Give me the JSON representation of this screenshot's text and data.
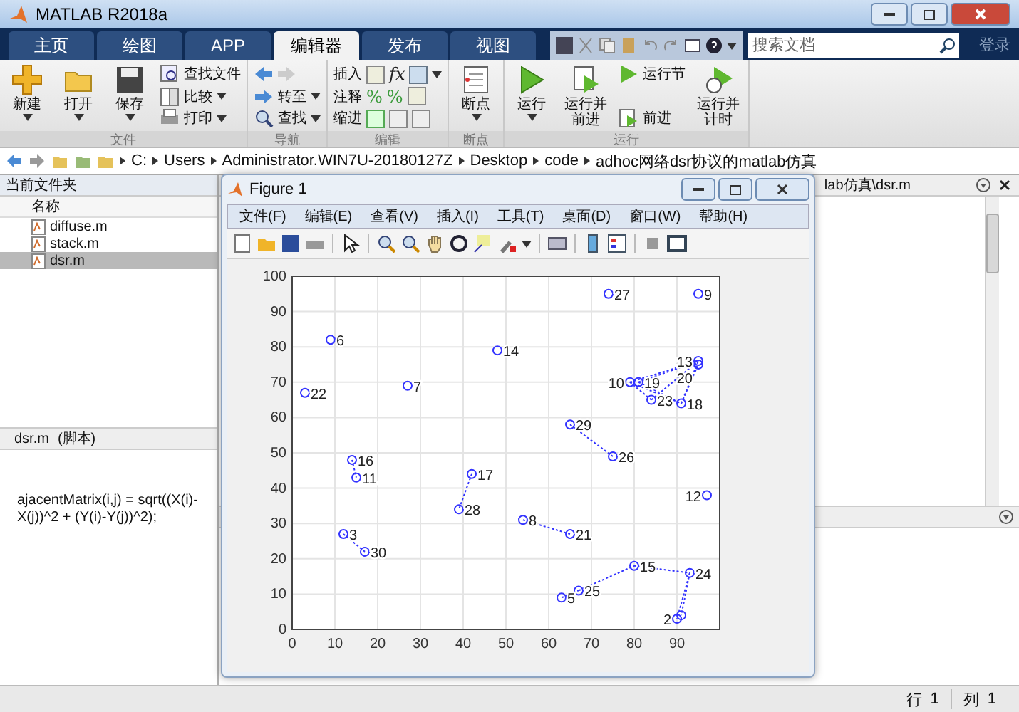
{
  "window": {
    "title": "MATLAB R2018a"
  },
  "tabs": [
    {
      "label": "主页",
      "selected": false
    },
    {
      "label": "绘图",
      "selected": false
    },
    {
      "label": "APP",
      "selected": false
    },
    {
      "label": "编辑器",
      "selected": true
    },
    {
      "label": "发布",
      "selected": false
    },
    {
      "label": "视图",
      "selected": false
    }
  ],
  "search": {
    "placeholder": "搜索文档"
  },
  "login": "登录",
  "ribbon": [
    {
      "title": "文件",
      "items": [
        {
          "kind": "large",
          "label": "新建",
          "dropdown": true
        },
        {
          "kind": "large",
          "label": "打开",
          "dropdown": true
        },
        {
          "kind": "large",
          "label": "保存",
          "dropdown": true
        },
        {
          "kind": "stack",
          "rows": [
            {
              "label": "查找文件",
              "dropdown": false
            },
            {
              "label": "比较",
              "dropdown": true
            },
            {
              "label": "打印",
              "dropdown": true
            }
          ]
        }
      ]
    },
    {
      "title": "导航",
      "items": [
        {
          "kind": "stack",
          "rows": [
            {
              "dropdown": false
            },
            {
              "label": "转至",
              "dropdown": true
            },
            {
              "label": "查找",
              "dropdown": true
            }
          ]
        }
      ]
    },
    {
      "title": "编辑",
      "items": [
        {
          "kind": "stack",
          "rows": [
            {
              "label": "插入",
              "glyphs": [
                "fx"
              ],
              "dropdown": true
            },
            {
              "label": "注释",
              "glyphs": [
                "%",
                "%"
              ],
              "dropdown": false
            },
            {
              "label": "缩进",
              "dropdown": false
            }
          ]
        }
      ]
    },
    {
      "title": "断点",
      "items": [
        {
          "kind": "large",
          "label": "断点",
          "dropdown": true
        }
      ]
    },
    {
      "title": "运行",
      "items": [
        {
          "kind": "large",
          "label": "运行",
          "dropdown": true
        },
        {
          "kind": "large",
          "label": "运行并前进",
          "dropdown": false
        },
        {
          "kind": "stack",
          "rows": [
            {
              "label": "运行节",
              "dropdown": false
            },
            {
              "label": "前进",
              "dropdown": false
            }
          ]
        },
        {
          "kind": "large",
          "label": "运行并计时",
          "dropdown": false
        }
      ]
    }
  ],
  "address": [
    "C:",
    "Users",
    "Administrator.WIN7U-20180127Z",
    "Desktop",
    "code",
    "adhoc网络dsr协议的matlab仿真"
  ],
  "file_browser": {
    "title": "当前文件夹",
    "column": "名称",
    "files": [
      {
        "name": "diffuse.m",
        "selected": false
      },
      {
        "name": "stack.m",
        "selected": false
      },
      {
        "name": "dsr.m",
        "selected": true
      }
    ]
  },
  "details": {
    "title": "dsr.m",
    "subtitle": "(脚本)",
    "text": "ajacentMatrix(i,j) = sqrt((X(i)-X(j))^2 + (Y(i)-Y(j))^2);"
  },
  "editor": {
    "tab": "lab仿真\\dsr.m"
  },
  "status_bar": {
    "row_label": "行",
    "row": "1",
    "col_label": "列",
    "col": "1"
  },
  "figure": {
    "title": "Figure 1",
    "menu": [
      "文件(F)",
      "编辑(E)",
      "查看(V)",
      "插入(I)",
      "工具(T)",
      "桌面(D)",
      "窗口(W)",
      "帮助(H)"
    ],
    "chart_data": {
      "type": "scatter",
      "xlim": [
        0,
        100
      ],
      "ylim": [
        0,
        100
      ],
      "xticks": [
        0,
        10,
        20,
        30,
        40,
        50,
        60,
        70,
        80,
        90
      ],
      "yticks": [
        0,
        10,
        20,
        30,
        40,
        50,
        60,
        70,
        80,
        90,
        100
      ],
      "x": [
        74,
        95,
        9,
        48,
        95,
        95,
        3,
        27,
        79,
        81,
        84,
        91,
        65,
        75,
        14,
        15,
        42,
        97,
        39,
        54,
        65,
        12,
        17,
        80,
        93,
        67,
        63,
        90,
        91
      ],
      "series": [
        {
          "color": "#3333ff",
          "values": [
            95,
            95,
            82,
            79,
            76,
            75,
            67,
            69,
            70,
            70,
            65,
            64,
            58,
            49,
            48,
            43,
            44,
            38,
            34,
            31,
            27,
            27,
            22,
            18,
            16,
            11,
            9,
            3,
            4
          ]
        }
      ],
      "value_labels": [
        "27",
        "9",
        "6",
        "14",
        "13",
        "20",
        "22",
        "7",
        "10",
        "19",
        "23",
        "18",
        "29",
        "26",
        "16",
        "11",
        "17",
        "12",
        "28",
        "8",
        "21",
        "3",
        "30",
        "15",
        "24",
        "25",
        "5",
        "2",
        null
      ],
      "grid": true
    }
  }
}
